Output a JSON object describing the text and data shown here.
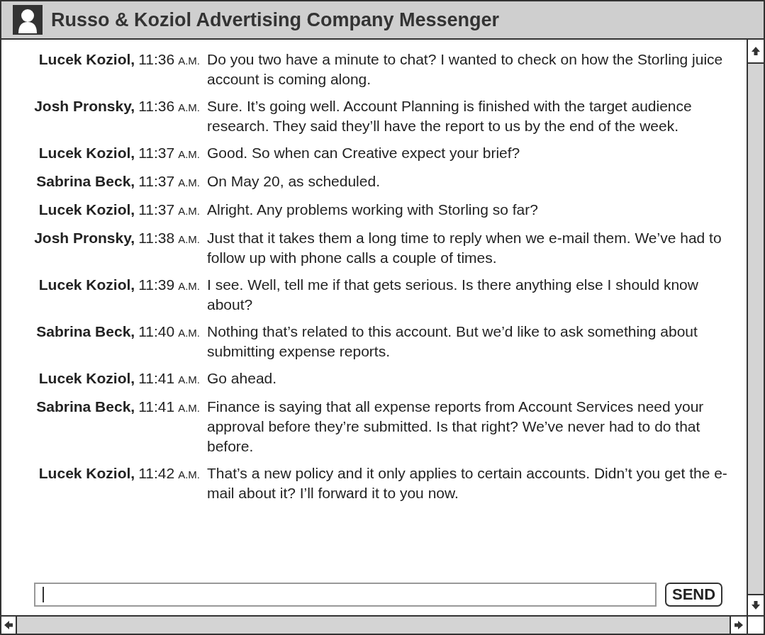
{
  "window": {
    "title": "Russo & Koziol Advertising Company Messenger"
  },
  "messages": [
    {
      "sender": "Lucek Koziol,",
      "time": "11:36",
      "meridiem": "A.M.",
      "text": "Do you two have a minute to chat? I wanted to check on how the Storling juice account is coming along."
    },
    {
      "sender": "Josh Pronsky,",
      "time": "11:36",
      "meridiem": "A.M.",
      "text": "Sure. It’s going well. Account Planning is finished with the target audience research. They said they’ll have the report to us by the end of the week."
    },
    {
      "sender": "Lucek Koziol,",
      "time": "11:37",
      "meridiem": "A.M.",
      "text": "Good. So when can Creative expect your brief?"
    },
    {
      "sender": "Sabrina Beck,",
      "time": "11:37",
      "meridiem": "A.M.",
      "text": "On May 20, as scheduled."
    },
    {
      "sender": "Lucek Koziol,",
      "time": "11:37",
      "meridiem": "A.M.",
      "text": "Alright. Any problems working with Storling so far?"
    },
    {
      "sender": "Josh Pronsky,",
      "time": "11:38",
      "meridiem": "A.M.",
      "text": "Just that it takes them a long time to reply when we e-mail them. We’ve had to follow up with phone calls a couple of times."
    },
    {
      "sender": "Lucek Koziol,",
      "time": "11:39",
      "meridiem": "A.M.",
      "text": "I see. Well, tell me if that gets serious. Is there anything else I should know about?"
    },
    {
      "sender": "Sabrina Beck,",
      "time": "11:40",
      "meridiem": "A.M.",
      "text": "Nothing that’s related to this account. But we’d like to ask something about submitting expense reports."
    },
    {
      "sender": "Lucek Koziol,",
      "time": "11:41",
      "meridiem": "A.M.",
      "text": "Go ahead."
    },
    {
      "sender": "Sabrina Beck,",
      "time": "11:41",
      "meridiem": "A.M.",
      "text": "Finance is saying that all expense reports from Account Services need your approval before they’re submitted. Is that right? We’ve never had to do that before."
    },
    {
      "sender": "Lucek Koziol,",
      "time": "11:42",
      "meridiem": "A.M.",
      "text": "That’s a new policy and it only applies to certain accounts. Didn’t you get the e-mail about it? I’ll forward it to you now."
    }
  ],
  "composer": {
    "send_button": "SEND"
  }
}
